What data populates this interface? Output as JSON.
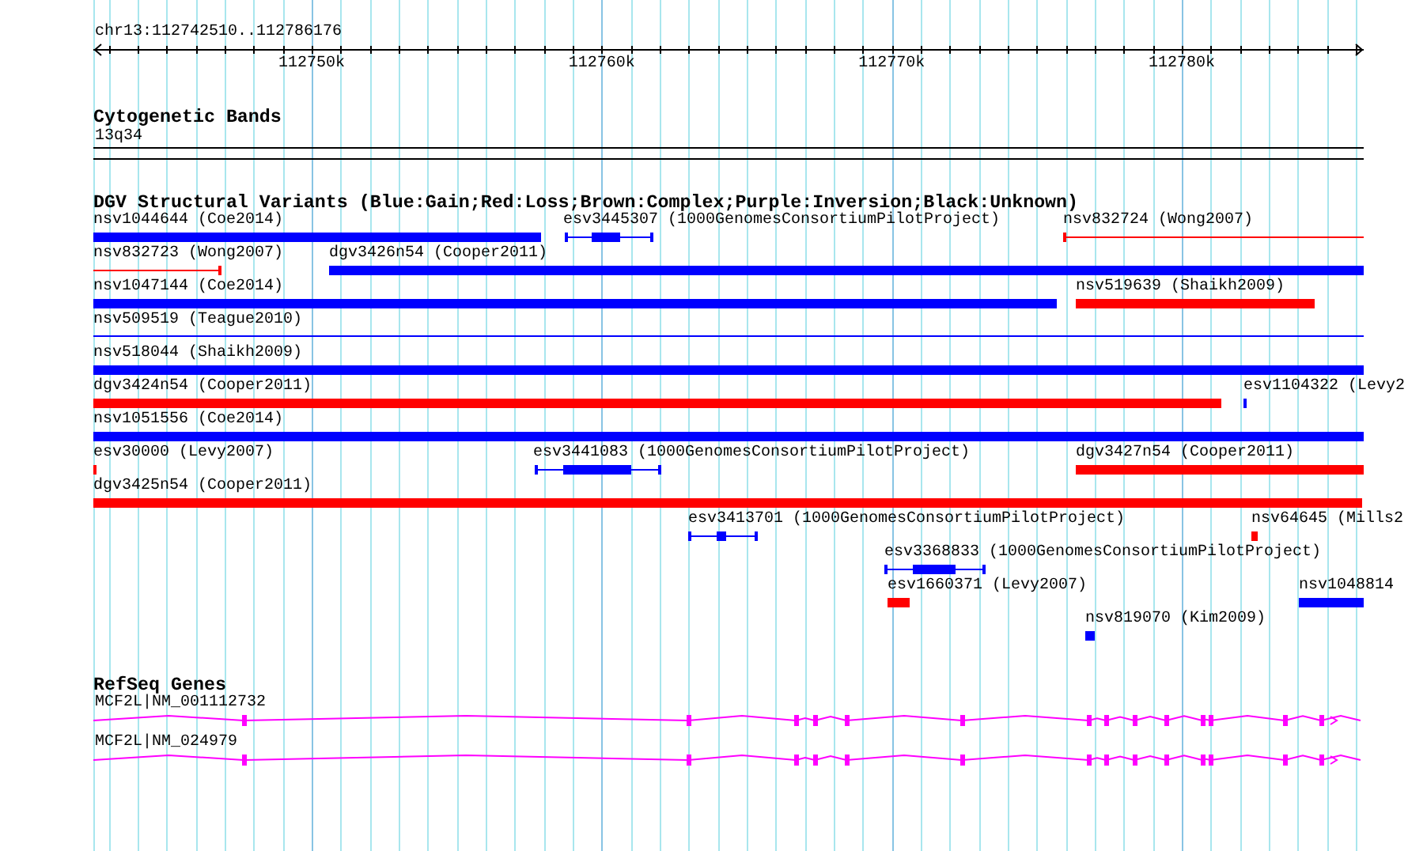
{
  "ruler": {
    "label": "chr13:112742510..112786176",
    "ticks": [
      "112750k",
      "112760k",
      "112770k",
      "112780k"
    ]
  },
  "tracks": [
    {
      "kind": "cytoband",
      "title": "Cytogenetic Bands",
      "features": [
        {
          "label": "13q34"
        }
      ]
    },
    {
      "kind": "variants",
      "title": "DGV Structural Variants (Blue:Gain;Red:Loss;Brown:Complex;Purple:Inversion;Black:Unknown)",
      "features": [
        {
          "label": "nsv1044644 (Coe2014)",
          "color": "#0000ff",
          "kind": "bar"
        },
        {
          "label": "esv3445307 (1000GenomesConsortiumPilotProject)",
          "color": "#0000ff",
          "kind": "whisker"
        },
        {
          "label": "nsv832724 (Wong2007)",
          "color": "#ff0000",
          "kind": "whisker"
        },
        {
          "label": "nsv832723 (Wong2007)",
          "color": "#ff0000",
          "kind": "whisker"
        },
        {
          "label": "dgv3426n54 (Cooper2011)",
          "color": "#0000ff",
          "kind": "bar"
        },
        {
          "label": "nsv1047144 (Coe2014)",
          "color": "#0000ff",
          "kind": "bar"
        },
        {
          "label": "nsv519639 (Shaikh2009)",
          "color": "#ff0000",
          "kind": "bar"
        },
        {
          "label": "nsv509519 (Teague2010)",
          "color": "#0000ff",
          "kind": "line"
        },
        {
          "label": "nsv518044 (Shaikh2009)",
          "color": "#0000ff",
          "kind": "bar"
        },
        {
          "label": "dgv3424n54 (Cooper2011)",
          "color": "#ff0000",
          "kind": "bar"
        },
        {
          "label": "esv1104322 (Levy2",
          "color": "#0000ff",
          "kind": "bar"
        },
        {
          "label": "nsv1051556 (Coe2014)",
          "color": "#0000ff",
          "kind": "bar"
        },
        {
          "label": "esv30000 (Levy2007)",
          "color": "#ff0000",
          "kind": "bar"
        },
        {
          "label": "esv3441083 (1000GenomesConsortiumPilotProject)",
          "color": "#0000ff",
          "kind": "whisker"
        },
        {
          "label": "dgv3427n54 (Cooper2011)",
          "color": "#ff0000",
          "kind": "bar"
        },
        {
          "label": "dgv3425n54 (Cooper2011)",
          "color": "#ff0000",
          "kind": "bar"
        },
        {
          "label": "esv3413701 (1000GenomesConsortiumPilotProject)",
          "color": "#0000ff",
          "kind": "whisker"
        },
        {
          "label": "nsv64645 (Mills2",
          "color": "#ff0000",
          "kind": "bar"
        },
        {
          "label": "esv3368833 (1000GenomesConsortiumPilotProject)",
          "color": "#0000ff",
          "kind": "whisker"
        },
        {
          "label": "esv1660371 (Levy2007)",
          "color": "#ff0000",
          "kind": "bar"
        },
        {
          "label": "nsv1048814",
          "color": "#0000ff",
          "kind": "bar"
        },
        {
          "label": "nsv819070 (Kim2009)",
          "color": "#0000ff",
          "kind": "bar"
        }
      ]
    },
    {
      "kind": "genes",
      "title": "RefSeq Genes",
      "features": [
        {
          "label": "MCF2L|NM_001112732"
        },
        {
          "label": "MCF2L|NM_024979"
        }
      ]
    }
  ]
}
